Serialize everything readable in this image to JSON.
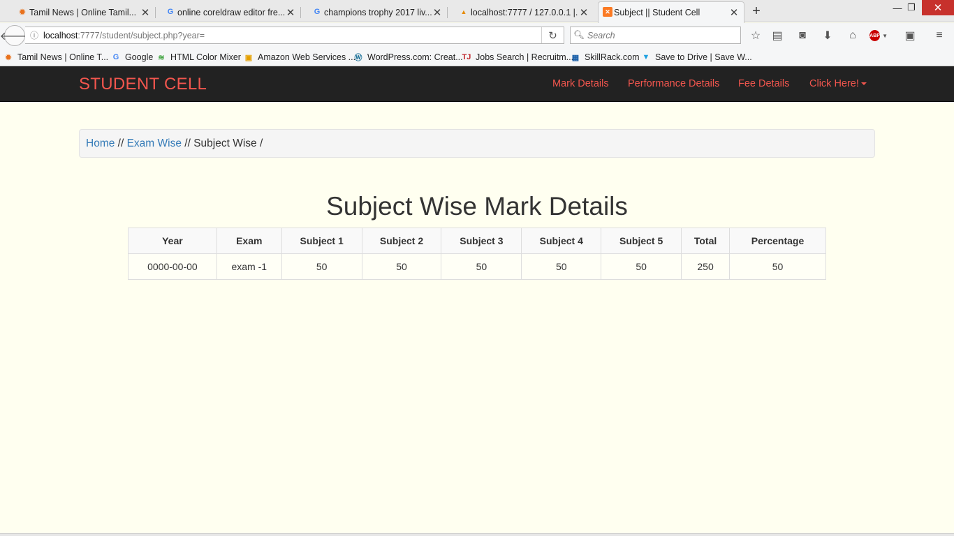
{
  "browser": {
    "tabs": [
      {
        "title": "Tamil News | Online Tamil...",
        "icon": "sun-icon"
      },
      {
        "title": "online coreldraw editor fre...",
        "icon": "google-icon"
      },
      {
        "title": "champions trophy 2017 liv...",
        "icon": "google-icon"
      },
      {
        "title": "localhost:7777 / 127.0.0.1 |...",
        "icon": "phpmyadmin-icon"
      },
      {
        "title": "Subject || Student Cell",
        "icon": "xampp-icon"
      }
    ],
    "new_tab_label": "+",
    "url_host": "localhost",
    "url_path": ":7777/student/subject.php?year=",
    "search_placeholder": "Search",
    "bookmarks": [
      {
        "label": "Tamil News | Online T...",
        "icon": "sun-icon"
      },
      {
        "label": "Google",
        "icon": "google-icon"
      },
      {
        "label": "HTML Color Mixer",
        "icon": "color-mixer-icon"
      },
      {
        "label": "Amazon Web Services ...",
        "icon": "box-icon"
      },
      {
        "label": "WordPress.com: Creat...",
        "icon": "wordpress-icon"
      },
      {
        "label": "Jobs Search | Recruitm...",
        "icon": "tj-icon"
      },
      {
        "label": "SkillRack.com",
        "icon": "skillrack-icon"
      },
      {
        "label": "Save to Drive | Save W...",
        "icon": "drive-icon"
      }
    ],
    "abp_label": "ABP"
  },
  "site": {
    "brand": "STUDENT CELL",
    "nav": {
      "mark_details": "Mark Details",
      "performance_details": "Performance Details",
      "fee_details": "Fee Details",
      "click_here": "Click Here!"
    },
    "breadcrumb": {
      "home": "Home",
      "sep1": " // ",
      "exam_wise": "Exam Wise",
      "sep2": " // ",
      "current": "Subject Wise /"
    },
    "heading": "Subject Wise Mark Details",
    "table": {
      "headers": [
        "Year",
        "Exam",
        "Subject 1",
        "Subject 2",
        "Subject 3",
        "Subject 4",
        "Subject 5",
        "Total",
        "Percentage"
      ],
      "rows": [
        [
          "0000-00-00",
          "exam -1",
          "50",
          "50",
          "50",
          "50",
          "50",
          "250",
          "50"
        ]
      ]
    }
  },
  "colors": {
    "brand": "#f2564e",
    "navbar_bg": "#222222",
    "page_bg": "#fffff0",
    "link": "#337ab7"
  }
}
